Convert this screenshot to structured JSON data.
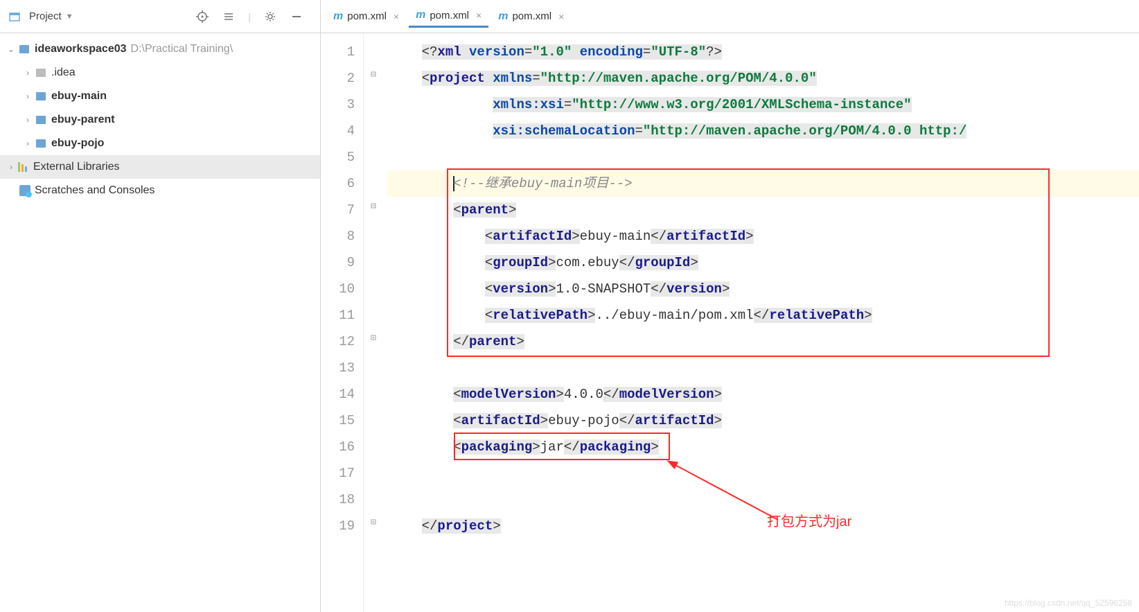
{
  "toolbar": {
    "project_label": "Project"
  },
  "tabs": [
    {
      "label": "pom.xml",
      "active": false
    },
    {
      "label": "pom.xml",
      "active": true
    },
    {
      "label": "pom.xml",
      "active": false
    }
  ],
  "tree": {
    "root": {
      "name": "ideaworkspace03",
      "path": "D:\\Practical Training\\"
    },
    "items": [
      {
        "name": ".idea",
        "kind": "folder-grey"
      },
      {
        "name": "ebuy-main",
        "kind": "folder"
      },
      {
        "name": "ebuy-parent",
        "kind": "folder"
      },
      {
        "name": "ebuy-pojo",
        "kind": "folder"
      }
    ],
    "ext_lib": "External Libraries",
    "scratches": "Scratches and Consoles"
  },
  "code": {
    "l1": {
      "version": "\"1.0\"",
      "encoding": "\"UTF-8\""
    },
    "l2": {
      "xmlns": "\"http://maven.apache.org/POM/4.0.0\""
    },
    "l3": {
      "xsi": "\"http://www.w3.org/2001/XMLSchema-instance\""
    },
    "l4": {
      "loc": "\"http://maven.apache.org/POM/4.0.0 http:/"
    },
    "l6_comment": "<!--继承ebuy-main项目-->",
    "parent": {
      "artifactId": "ebuy-main",
      "groupId": "com.ebuy",
      "version": "1.0-SNAPSHOT",
      "relativePath": "../ebuy-main/pom.xml"
    },
    "modelVersion": "4.0.0",
    "artifactId": "ebuy-pojo",
    "packaging": "jar"
  },
  "line_numbers": [
    "1",
    "2",
    "3",
    "4",
    "5",
    "6",
    "7",
    "8",
    "9",
    "10",
    "11",
    "12",
    "13",
    "14",
    "15",
    "16",
    "17",
    "18",
    "19"
  ],
  "annotation": "打包方式为jar",
  "watermark": "https://blog.csdn.net/qq_52596258"
}
